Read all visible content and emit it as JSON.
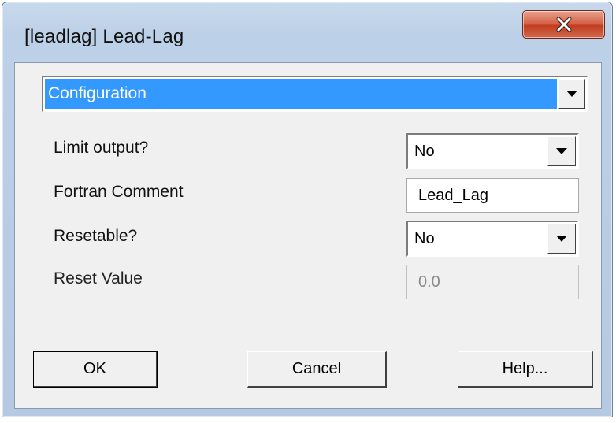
{
  "window": {
    "title": "[leadlag] Lead-Lag"
  },
  "section": {
    "selected": "Configuration"
  },
  "fields": {
    "limit_output": {
      "label": "Limit output?",
      "value": "No"
    },
    "fortran_comment": {
      "label": "Fortran Comment",
      "value": "Lead_Lag"
    },
    "resetable": {
      "label": "Resetable?",
      "value": "No"
    },
    "reset_value": {
      "label": "Reset Value",
      "value": "0.0"
    }
  },
  "buttons": {
    "ok": "OK",
    "cancel": "Cancel",
    "help": "Help..."
  },
  "icons": {
    "close": "close-icon",
    "dropdown": "chevron-down-icon"
  },
  "colors": {
    "selection": "#3399ff",
    "close_button": "#c94a2f"
  }
}
